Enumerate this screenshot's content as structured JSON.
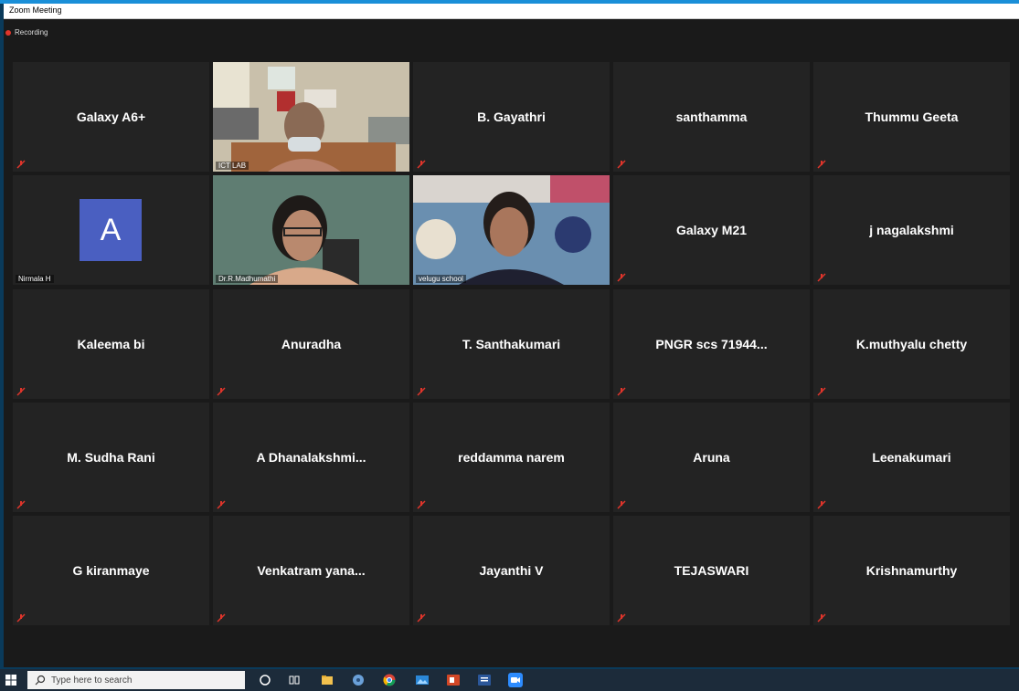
{
  "window": {
    "title": "Zoom Meeting",
    "recording_label": "Recording"
  },
  "tiles": [
    {
      "name": "Galaxy A6+"
    },
    {
      "label": "ICT LAB"
    },
    {
      "name": "B. Gayathri"
    },
    {
      "name": "santhamma"
    },
    {
      "name": "Thummu Geeta"
    },
    {
      "label": "Nirmala H",
      "avatar": "A"
    },
    {
      "label": "Dr.R.Madhumathi"
    },
    {
      "label": "velugu school"
    },
    {
      "name": "Galaxy M21"
    },
    {
      "name": "j nagalakshmi"
    },
    {
      "name": "Kaleema bi"
    },
    {
      "name": "Anuradha"
    },
    {
      "name": "T. Santhakumari"
    },
    {
      "name": "PNGR scs 71944..."
    },
    {
      "name": "K.muthyalu chetty"
    },
    {
      "name": "M. Sudha Rani"
    },
    {
      "name": "A  Dhanalakshmi..."
    },
    {
      "name": "reddamma narem"
    },
    {
      "name": "Aruna"
    },
    {
      "name": "Leenakumari"
    },
    {
      "name": "G kiranmaye"
    },
    {
      "name": "Venkatram  yana..."
    },
    {
      "name": "Jayanthi  V"
    },
    {
      "name": "TEJASWARI"
    },
    {
      "name": "Krishnamurthy"
    }
  ],
  "taskbar": {
    "search_placeholder": "Type here to search"
  },
  "colors": {
    "accent": "#1a8fd8",
    "tile_bg": "#232323",
    "active_border": "#d6e04a",
    "avatar_bg": "#4a5fc1",
    "mute_red": "#e0352b"
  }
}
